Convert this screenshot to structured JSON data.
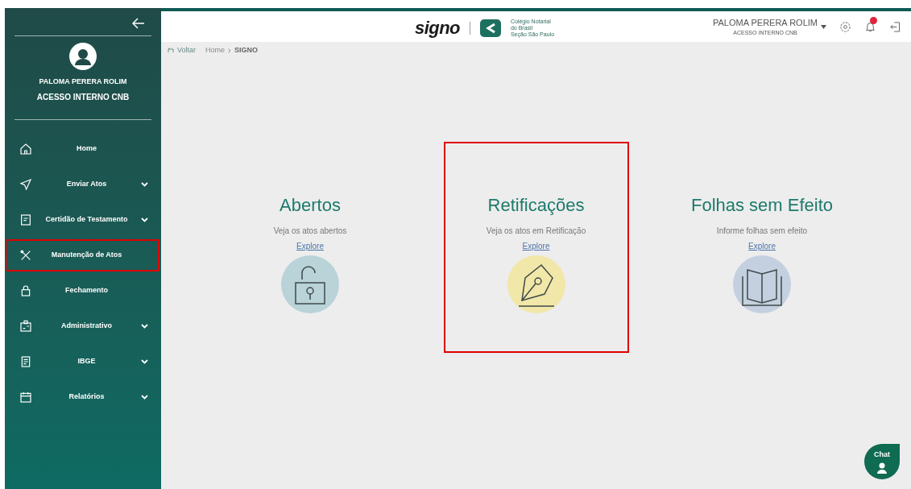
{
  "sidebar": {
    "user_name": "PALOMA PERERA ROLIM",
    "user_role": "ACESSO INTERNO CNB",
    "items": [
      {
        "label": "Home",
        "kind": "home",
        "expandable": false,
        "highlighted": false
      },
      {
        "label": "Enviar Atos",
        "kind": "send",
        "expandable": true,
        "highlighted": false
      },
      {
        "label": "Certidão de Testamento",
        "kind": "document",
        "expandable": true,
        "highlighted": false
      },
      {
        "label": "Manutenção de Atos",
        "kind": "tools",
        "expandable": false,
        "highlighted": true
      },
      {
        "label": "Fechamento",
        "kind": "lock",
        "expandable": false,
        "highlighted": false
      },
      {
        "label": "Administrativo",
        "kind": "badge",
        "expandable": true,
        "highlighted": false
      },
      {
        "label": "IBGE",
        "kind": "form",
        "expandable": true,
        "highlighted": false
      },
      {
        "label": "Relatórios",
        "kind": "calendar",
        "expandable": true,
        "highlighted": false
      }
    ]
  },
  "header": {
    "logo": "signo",
    "org_lines": [
      "Colégio Notarial",
      "do Brasil",
      "Seção São Paulo"
    ],
    "user_name": "PALOMA PERERA ROLIM",
    "user_role": "ACESSO INTERNO CNB"
  },
  "breadcrumb": {
    "back": "Voltar",
    "items": [
      "Home",
      "SIGNO"
    ]
  },
  "cards": [
    {
      "title": "Abertos",
      "description": "Veja os atos abertos",
      "link": "Explore",
      "kind": "padlock",
      "color": "#b9d3d8",
      "highlighted": false
    },
    {
      "title": "Retificações",
      "description": "Veja os atos em Retificação",
      "link": "Explore",
      "kind": "pen",
      "color": "#f1e7a8",
      "highlighted": true
    },
    {
      "title": "Folhas sem Efeito",
      "description": "Informe folhas sem efeito",
      "link": "Explore",
      "kind": "book",
      "color": "#c4d0df",
      "highlighted": false
    }
  ],
  "chat": {
    "label": "Chat"
  }
}
